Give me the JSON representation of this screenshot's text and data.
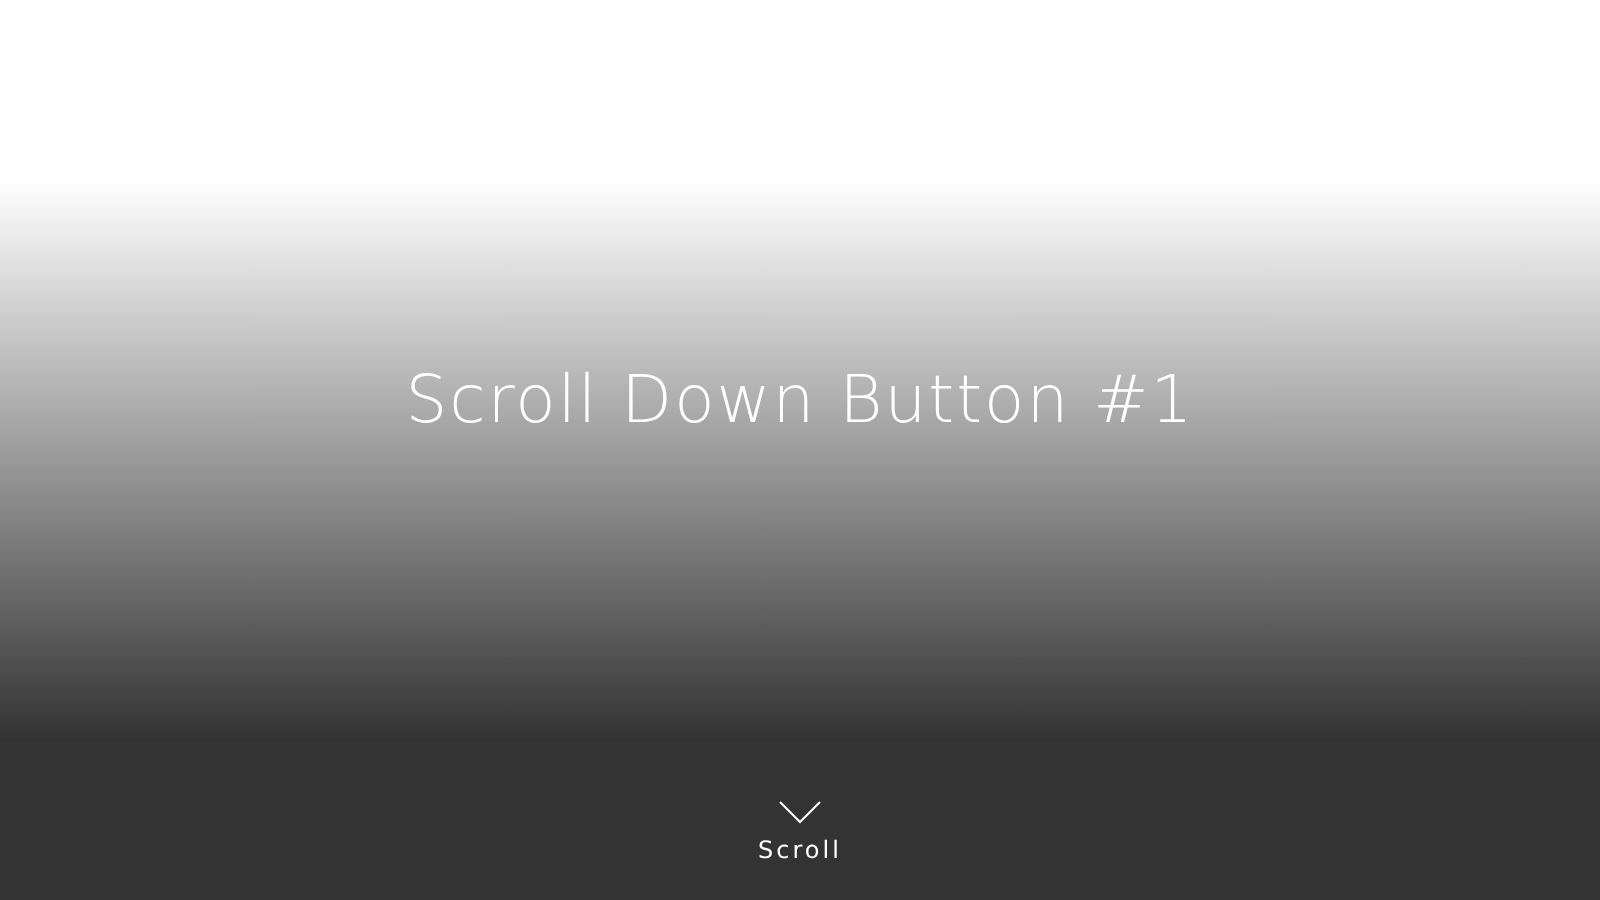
{
  "heading": "Scroll Down Button #1",
  "scroll_button": {
    "label": "Scroll"
  }
}
